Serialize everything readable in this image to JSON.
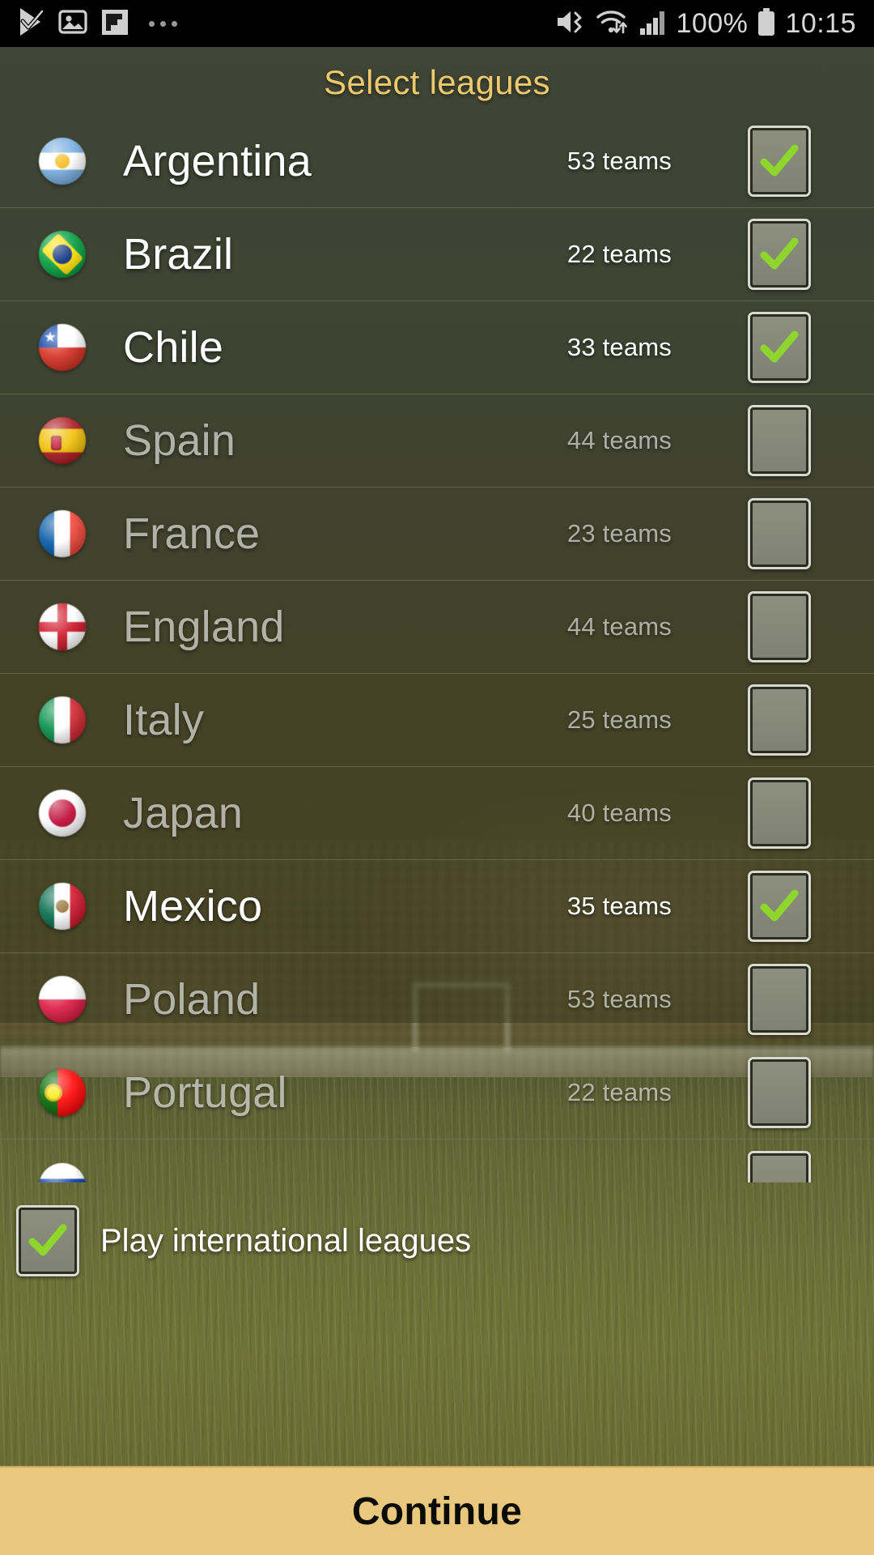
{
  "statusbar": {
    "left_icons": [
      "play-store-check-icon",
      "photo-icon",
      "flipboard-icon",
      "more-dots-icon"
    ],
    "right_icons": [
      "mute-icon",
      "wifi-icon",
      "signal-bars-icon",
      "battery-icon"
    ],
    "battery_text": "100%",
    "time": "10:15"
  },
  "header": {
    "title": "Select leagues"
  },
  "list": {
    "rows": [
      {
        "name": "Argentina",
        "teams": "53 teams",
        "checked": true,
        "flag": "flag-argentina-icon"
      },
      {
        "name": "Brazil",
        "teams": "22 teams",
        "checked": true,
        "flag": "flag-brazil-icon"
      },
      {
        "name": "Chile",
        "teams": "33 teams",
        "checked": true,
        "flag": "flag-chile-icon"
      },
      {
        "name": "Spain",
        "teams": "44 teams",
        "checked": false,
        "flag": "flag-spain-icon"
      },
      {
        "name": "France",
        "teams": "23 teams",
        "checked": false,
        "flag": "flag-france-icon"
      },
      {
        "name": "England",
        "teams": "44 teams",
        "checked": false,
        "flag": "flag-england-icon"
      },
      {
        "name": "Italy",
        "teams": "25 teams",
        "checked": false,
        "flag": "flag-italy-icon"
      },
      {
        "name": "Japan",
        "teams": "40 teams",
        "checked": false,
        "flag": "flag-japan-icon"
      },
      {
        "name": "Mexico",
        "teams": "35 teams",
        "checked": true,
        "flag": "flag-mexico-icon"
      },
      {
        "name": "Poland",
        "teams": "53 teams",
        "checked": false,
        "flag": "flag-poland-icon"
      },
      {
        "name": "Portugal",
        "teams": "22 teams",
        "checked": false,
        "flag": "flag-portugal-icon"
      },
      {
        "name": "",
        "teams": "",
        "checked": false,
        "flag": "flag-russia-icon"
      }
    ]
  },
  "international": {
    "label": "Play international leagues",
    "checked": true
  },
  "footer": {
    "continue_label": "Continue"
  },
  "colors": {
    "title": "#edc96d",
    "checkmark_green": "#8ed62e",
    "continue_bg": "#e9c87e",
    "continue_text": "#0b0b06",
    "row_text_on": "#ffffff",
    "row_text_off": "#c9cbc2",
    "statusbar_bg": "#000000"
  }
}
